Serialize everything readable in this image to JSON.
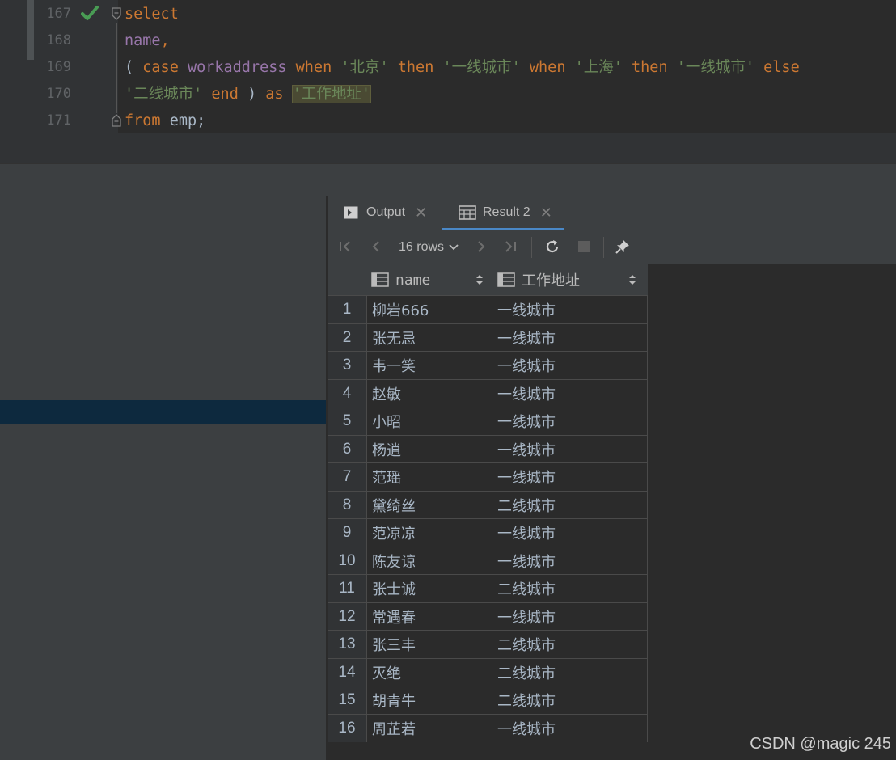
{
  "editor": {
    "line_numbers": [
      "167",
      "168",
      "169",
      "170",
      "171"
    ],
    "line167": {
      "kw_select": "select"
    },
    "line168": {
      "name": "name",
      "comma": ","
    },
    "line169": {
      "paren_open": "( ",
      "kw_case": "case",
      "col": "workaddress",
      "kw_when1": "when",
      "str1": "'北京'",
      "kw_then1": "then",
      "str2": "'一线城市'",
      "kw_when2": "when",
      "str3": "'上海'",
      "kw_then2": "then",
      "str4": "'一线城市'",
      "kw_else": "else"
    },
    "line170": {
      "str5": "'二线城市'",
      "kw_end": "end",
      "paren_close": ")",
      "kw_as": "as",
      "alias": "'工作地址'"
    },
    "line171": {
      "kw_from": "from",
      "table": "emp;"
    }
  },
  "tabs": [
    {
      "label": "Output",
      "icon": "console-icon"
    },
    {
      "label": "Result 2",
      "icon": "table-icon"
    }
  ],
  "toolbar": {
    "rows_label": "16 rows"
  },
  "grid": {
    "columns": [
      "name",
      "工作地址"
    ],
    "rows": [
      {
        "num": "1",
        "name": "柳岩666",
        "addr": "一线城市"
      },
      {
        "num": "2",
        "name": "张无忌",
        "addr": "一线城市"
      },
      {
        "num": "3",
        "name": "韦一笑",
        "addr": "一线城市"
      },
      {
        "num": "4",
        "name": "赵敏",
        "addr": "一线城市"
      },
      {
        "num": "5",
        "name": "小昭",
        "addr": "一线城市"
      },
      {
        "num": "6",
        "name": "杨逍",
        "addr": "一线城市"
      },
      {
        "num": "7",
        "name": "范瑶",
        "addr": "一线城市"
      },
      {
        "num": "8",
        "name": "黛绮丝",
        "addr": "二线城市"
      },
      {
        "num": "9",
        "name": "范凉凉",
        "addr": "一线城市"
      },
      {
        "num": "10",
        "name": "陈友谅",
        "addr": "一线城市"
      },
      {
        "num": "11",
        "name": "张士诚",
        "addr": "二线城市"
      },
      {
        "num": "12",
        "name": "常遇春",
        "addr": "一线城市"
      },
      {
        "num": "13",
        "name": "张三丰",
        "addr": "二线城市"
      },
      {
        "num": "14",
        "name": "灭绝",
        "addr": "二线城市"
      },
      {
        "num": "15",
        "name": "胡青牛",
        "addr": "二线城市"
      },
      {
        "num": "16",
        "name": "周芷若",
        "addr": "一线城市"
      }
    ]
  },
  "watermark": "CSDN @magic 245"
}
